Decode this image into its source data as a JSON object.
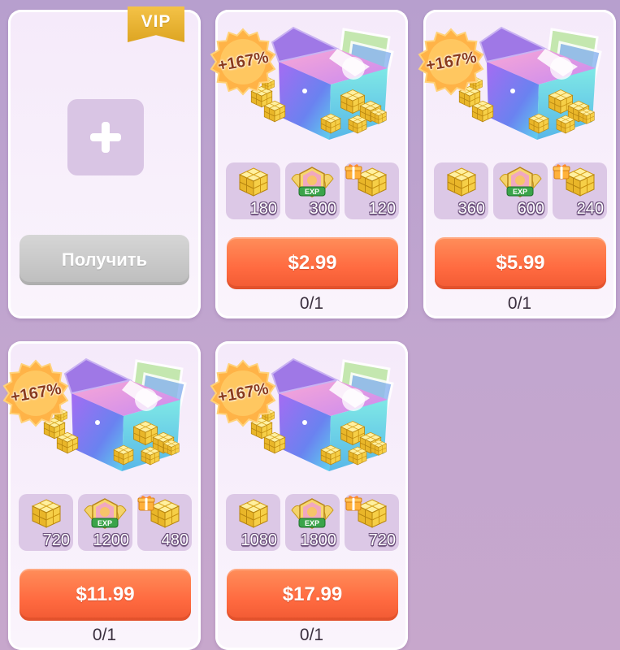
{
  "vip_slot": {
    "badge": "VIP",
    "claim_label": "Получить"
  },
  "colors": {
    "price_button": "#ff6a40",
    "claim_button": "#c9c9c9",
    "card_bg": "#f7eefb",
    "vip_badge": "#e8b431",
    "bonus_badge": "#ffb347"
  },
  "packs": [
    {
      "bonus": "+167%",
      "rewards": [
        {
          "icon": "gold-cube-icon",
          "count": "180"
        },
        {
          "icon": "exp-badge-icon",
          "count": "300"
        },
        {
          "icon": "gold-cube-icon",
          "count": "120",
          "bonus_gift": true
        }
      ],
      "price": "$2.99",
      "limit": "0/1"
    },
    {
      "bonus": "+167%",
      "rewards": [
        {
          "icon": "gold-cube-icon",
          "count": "360"
        },
        {
          "icon": "exp-badge-icon",
          "count": "600"
        },
        {
          "icon": "gold-cube-icon",
          "count": "240",
          "bonus_gift": true
        }
      ],
      "price": "$5.99",
      "limit": "0/1"
    },
    {
      "bonus": "+167%",
      "rewards": [
        {
          "icon": "gold-cube-icon",
          "count": "720"
        },
        {
          "icon": "exp-badge-icon",
          "count": "1200"
        },
        {
          "icon": "gold-cube-icon",
          "count": "480",
          "bonus_gift": true
        }
      ],
      "price": "$11.99",
      "limit": "0/1"
    },
    {
      "bonus": "+167%",
      "rewards": [
        {
          "icon": "gold-cube-icon",
          "count": "1080"
        },
        {
          "icon": "exp-badge-icon",
          "count": "1800"
        },
        {
          "icon": "gold-cube-icon",
          "count": "720",
          "bonus_gift": true
        }
      ],
      "price": "$17.99",
      "limit": "0/1"
    }
  ]
}
